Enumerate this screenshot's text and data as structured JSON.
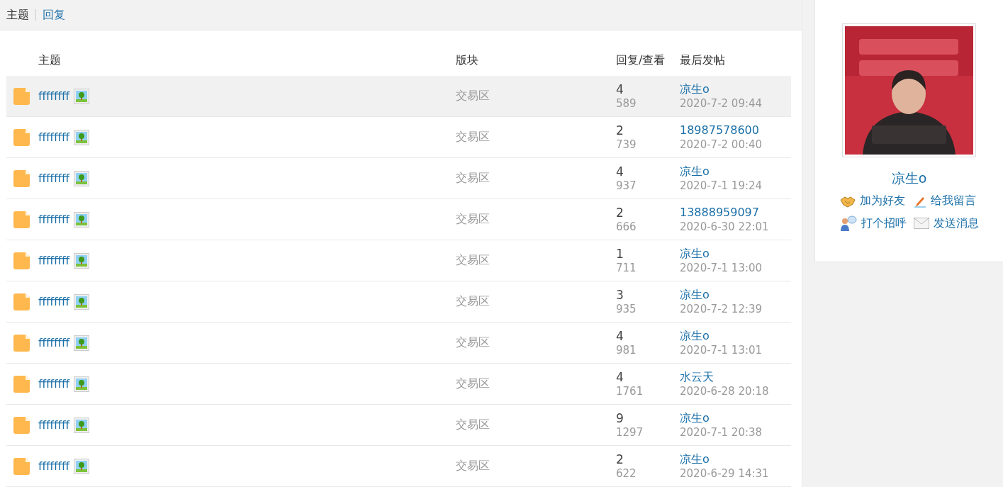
{
  "tabs": [
    {
      "label": "主题",
      "selected": true
    },
    {
      "label": "回复",
      "selected": false
    }
  ],
  "table": {
    "columns": [
      "主题",
      "版块",
      "回复/查看",
      "最后发帖"
    ],
    "rows": [
      {
        "title": "ffffffff",
        "forum": "交易区",
        "replies": "4",
        "views": "589",
        "last_user": "凉生o",
        "last_time": "2020-7-2 09:44",
        "selected": true
      },
      {
        "title": "ffffffff",
        "forum": "交易区",
        "replies": "2",
        "views": "739",
        "last_user": "18987578600",
        "last_time": "2020-7-2 00:40",
        "selected": false
      },
      {
        "title": "ffffffff",
        "forum": "交易区",
        "replies": "4",
        "views": "937",
        "last_user": "凉生o",
        "last_time": "2020-7-1 19:24",
        "selected": false
      },
      {
        "title": "ffffffff",
        "forum": "交易区",
        "replies": "2",
        "views": "666",
        "last_user": "13888959097",
        "last_time": "2020-6-30 22:01",
        "selected": false
      },
      {
        "title": "ffffffff",
        "forum": "交易区",
        "replies": "1",
        "views": "711",
        "last_user": "凉生o",
        "last_time": "2020-7-1 13:00",
        "selected": false
      },
      {
        "title": "ffffffff",
        "forum": "交易区",
        "replies": "3",
        "views": "935",
        "last_user": "凉生o",
        "last_time": "2020-7-2 12:39",
        "selected": false
      },
      {
        "title": "ffffffff",
        "forum": "交易区",
        "replies": "4",
        "views": "981",
        "last_user": "凉生o",
        "last_time": "2020-7-1 13:01",
        "selected": false
      },
      {
        "title": "ffffffff",
        "forum": "交易区",
        "replies": "4",
        "views": "1761",
        "last_user": "水云天",
        "last_time": "2020-6-28 20:18",
        "selected": false
      },
      {
        "title": "ffffffff",
        "forum": "交易区",
        "replies": "9",
        "views": "1297",
        "last_user": "凉生o",
        "last_time": "2020-7-1 20:38",
        "selected": false
      },
      {
        "title": "ffffffff",
        "forum": "交易区",
        "replies": "2",
        "views": "622",
        "last_user": "凉生o",
        "last_time": "2020-6-29 14:31",
        "selected": false
      }
    ]
  },
  "profile": {
    "name": "凉生o",
    "actions": [
      {
        "kind": "friend",
        "label": "加为好友"
      },
      {
        "kind": "message",
        "label": "给我留言"
      },
      {
        "kind": "greet",
        "label": "打个招呼"
      },
      {
        "kind": "mail",
        "label": "发送消息"
      }
    ]
  }
}
